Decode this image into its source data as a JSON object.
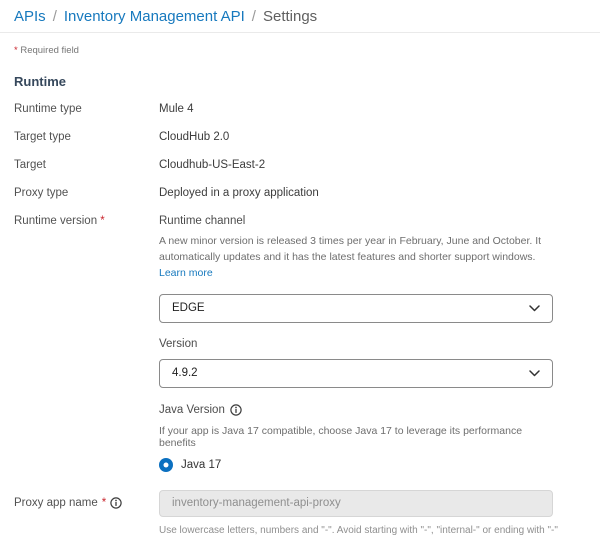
{
  "breadcrumb": {
    "separator": "/",
    "items": [
      {
        "label": "APIs"
      },
      {
        "label": "Inventory Management API"
      },
      {
        "label": "Settings"
      }
    ]
  },
  "required_note": {
    "asterisk": "*",
    "text": "Required field"
  },
  "runtime_section": {
    "title": "Runtime",
    "rows": [
      {
        "label": "Runtime type",
        "value": "Mule 4"
      },
      {
        "label": "Target type",
        "value": "CloudHub 2.0"
      },
      {
        "label": "Target",
        "value": "Cloudhub-US-East-2"
      },
      {
        "label": "Proxy type",
        "value": "Deployed in a proxy application"
      }
    ],
    "runtime_version": {
      "label": "Runtime version",
      "required_mark": "*",
      "channel": {
        "label": "Runtime channel",
        "description": "A new minor version is released 3 times per year in February, June and October. It automatically updates and it has the latest features and shorter support windows.",
        "learn_more_label": "Learn more",
        "selected": "EDGE"
      },
      "version": {
        "label": "Version",
        "selected": "4.9.2"
      },
      "java": {
        "label": "Java Version",
        "help": "If your app is Java 17 compatible, choose Java 17 to leverage its performance benefits",
        "option_label": "Java 17",
        "selected": true
      }
    },
    "proxy_app_name": {
      "label": "Proxy app name",
      "required_mark": "*",
      "value": "inventory-management-api-proxy",
      "help": "Use lowercase letters, numbers and \"-\". Avoid starting with \"-\", \"internal-\" or ending with \"-\""
    }
  },
  "colors": {
    "link_blue": "#1779be",
    "radio_blue": "#0b70c0",
    "required_red": "#c9252d",
    "disabled_input_bg": "#e9e9e9",
    "divider": "#eaeaea"
  }
}
